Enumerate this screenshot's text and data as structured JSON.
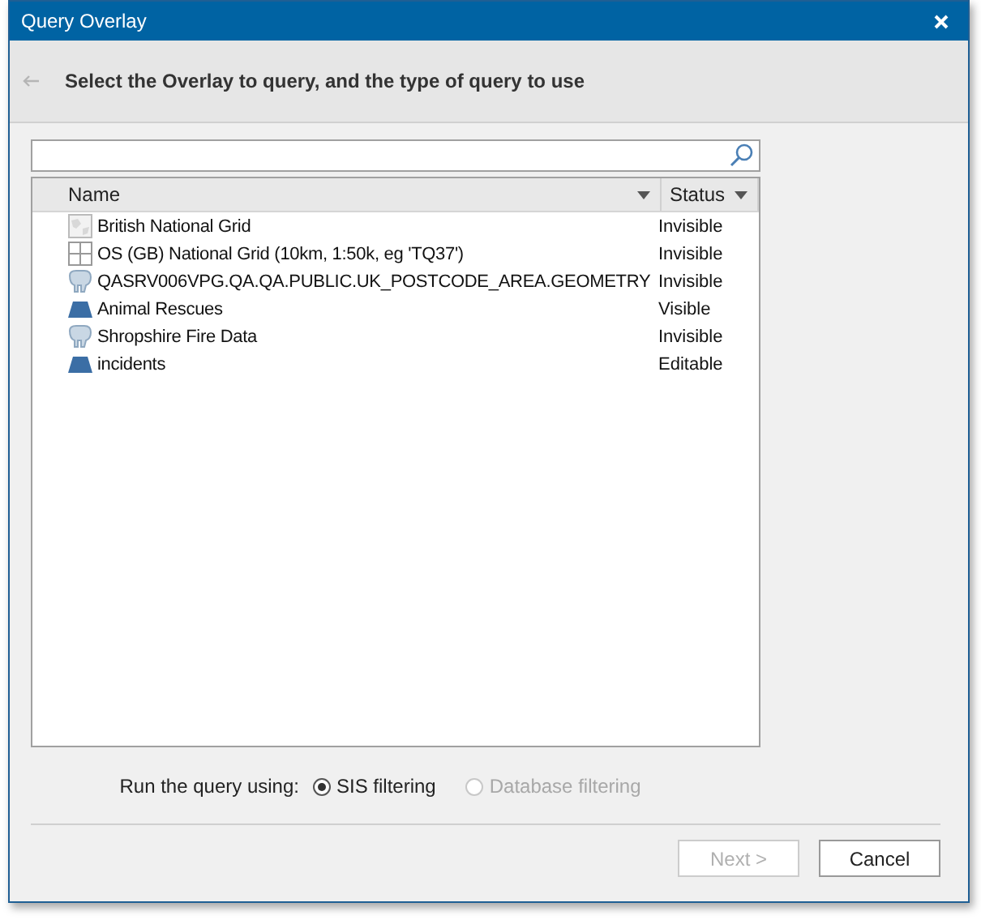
{
  "window": {
    "title": "Query Overlay"
  },
  "header": {
    "text": "Select the Overlay to query, and the type of query to use"
  },
  "table": {
    "columns": [
      "Name",
      "Status"
    ],
    "rows": [
      {
        "kind": "map",
        "name": "British National Grid",
        "status": "Invisible"
      },
      {
        "kind": "grid",
        "name": "OS (GB) National Grid (10km, 1:50k, eg 'TQ37')",
        "status": "Invisible"
      },
      {
        "kind": "database",
        "name": "QASRV006VPG.QA.QA.PUBLIC.UK_POSTCODE_AREA.GEOMETRY",
        "status": "Invisible"
      },
      {
        "kind": "polygon",
        "name": "Animal Rescues",
        "status": "Visible"
      },
      {
        "kind": "database",
        "name": "Shropshire Fire Data",
        "status": "Invisible"
      },
      {
        "kind": "polygon",
        "name": "incidents",
        "status": "Editable"
      }
    ]
  },
  "query_mode": {
    "label": "Run the query using:",
    "options": [
      {
        "label": "SIS filtering",
        "selected": true,
        "disabled": false
      },
      {
        "label": "Database filtering",
        "selected": false,
        "disabled": true
      }
    ]
  },
  "buttons": [
    {
      "label": "Next >",
      "disabled": true
    },
    {
      "label": "Cancel",
      "disabled": false
    }
  ]
}
